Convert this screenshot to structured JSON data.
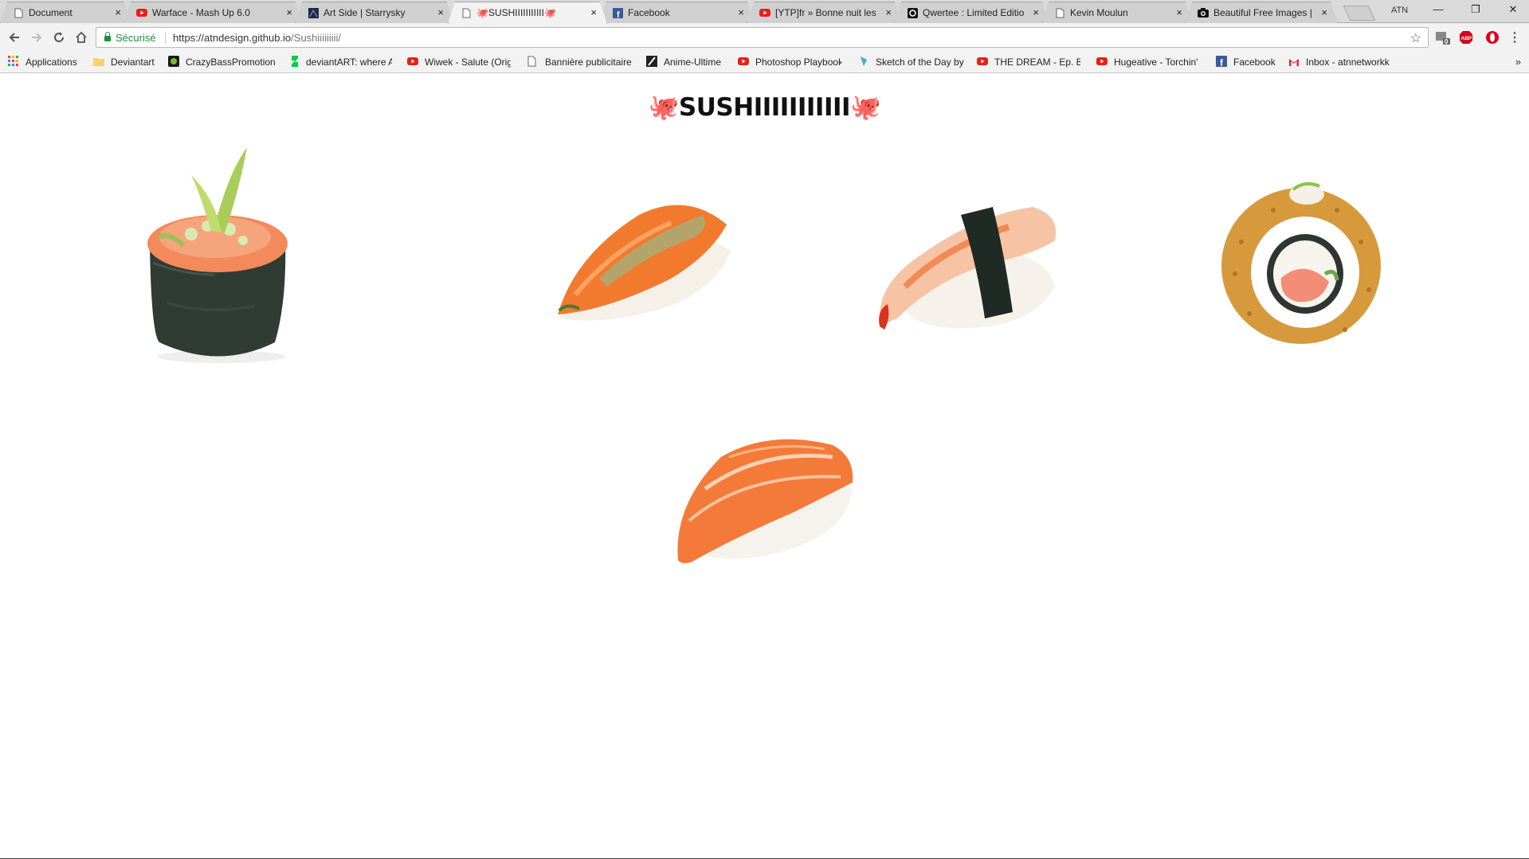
{
  "tabs": [
    {
      "title": "Document",
      "icon": "page-icon",
      "active": false
    },
    {
      "title": "Warface - Mash Up 6.0",
      "icon": "youtube-icon",
      "active": false
    },
    {
      "title": "Art Side | Starrysky",
      "icon": "artside-icon",
      "active": false
    },
    {
      "title": "🐙SUSHIIIIIIIIIII🐙",
      "icon": "page-icon",
      "active": true
    },
    {
      "title": "Facebook",
      "icon": "facebook-icon",
      "active": false
    },
    {
      "title": "[YTP]fr » Bonne nuit les",
      "icon": "youtube-icon",
      "active": false
    },
    {
      "title": "Qwertee : Limited Editio",
      "icon": "qwertee-icon",
      "active": false
    },
    {
      "title": "Kevin Moulun",
      "icon": "page-icon",
      "active": false
    },
    {
      "title": "Beautiful Free Images |",
      "icon": "camera-icon",
      "active": false
    }
  ],
  "tab_close_glyph": "×",
  "profile_label": "ATN",
  "window": {
    "minimize": "—",
    "restore": "❐",
    "close": "✕"
  },
  "toolbar": {
    "secure_label": "Sécurisé",
    "url_scheme_host": "https://atndesign.github.io",
    "url_path": "/Sushiiiiiiiii/"
  },
  "extensions": [
    {
      "name": "ext-badge",
      "badge": "0"
    },
    {
      "name": "adblock-plus",
      "label": "ABP"
    },
    {
      "name": "opera-icon",
      "label": ""
    }
  ],
  "bookmarks": [
    {
      "label": "Applications",
      "icon": "apps-grid-icon"
    },
    {
      "label": "Deviantart",
      "icon": "folder-icon"
    },
    {
      "label": "CrazyBassPromotion",
      "icon": "crazybass-icon"
    },
    {
      "label": "deviantART: where A",
      "icon": "deviantart-icon"
    },
    {
      "label": "Wiwek - Salute (Orig",
      "icon": "youtube-icon"
    },
    {
      "label": "Bannière publicitaire",
      "icon": "page-icon"
    },
    {
      "label": "Anime-Ultime",
      "icon": "anime-ultime-icon"
    },
    {
      "label": "Photoshop Playbook",
      "icon": "youtube-icon"
    },
    {
      "label": "Sketch of the Day by",
      "icon": "sketch-icon"
    },
    {
      "label": "THE DREAM - Ep. Bo",
      "icon": "youtube-icon"
    },
    {
      "label": "Hugeative - Torchin'",
      "icon": "youtube-icon"
    },
    {
      "label": "Facebook",
      "icon": "facebook-icon"
    },
    {
      "label": "Inbox - atnnetworkk",
      "icon": "gmail-icon"
    }
  ],
  "bookmarks_overflow": "»",
  "page": {
    "heading_emoji": "🐙",
    "heading_text": "SUSHIIIIIIIIIII",
    "items": [
      {
        "name": "gunkan-sushi-image",
        "type": "gunkan"
      },
      {
        "name": "salmon-nigiri-herb-image",
        "type": "salmon-herb"
      },
      {
        "name": "shrimp-nigiri-image",
        "type": "shrimp"
      },
      {
        "name": "tempura-roll-image",
        "type": "roll"
      },
      {
        "name": "salmon-nigiri-image",
        "type": "salmon"
      }
    ]
  },
  "colors": {
    "salmon": "#f47a3a",
    "salmon_light": "#ffb487",
    "rice": "#f5f1ea",
    "nori": "#2e3a32",
    "shrimp": "#f08a5a",
    "tempura": "#d69a3c",
    "octopus": "#e8742b"
  }
}
